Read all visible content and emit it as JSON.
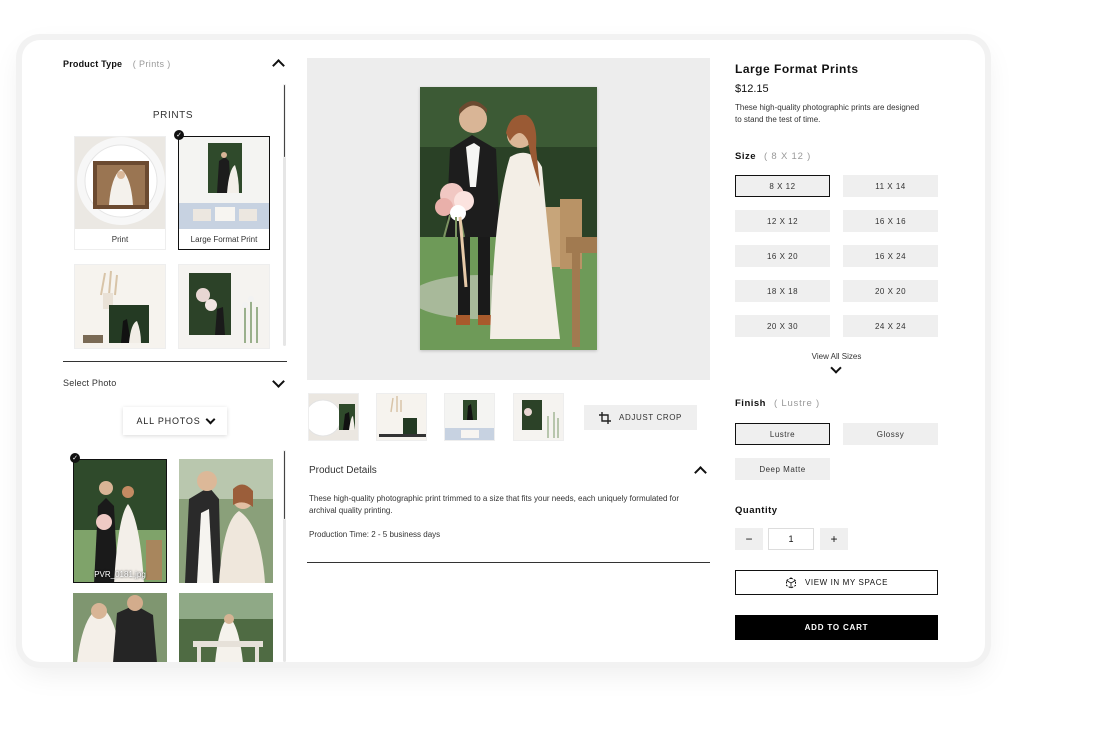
{
  "product_type": {
    "title": "Product Type",
    "selected": "( Prints )",
    "group_label": "PRINTS"
  },
  "product_tiles": [
    {
      "label": "Print"
    },
    {
      "label": "Large Format Print"
    },
    {
      "label": ""
    },
    {
      "label": ""
    }
  ],
  "select_photo": {
    "title": "Select Photo",
    "filter_label": "ALL PHOTOS"
  },
  "photos": [
    {
      "filename": "PVR_0181.jpg"
    }
  ],
  "actions": {
    "adjust_crop": "ADJUST CROP"
  },
  "product_details": {
    "title": "Product Details",
    "body": "These high-quality photographic print trimmed to a size that fits your needs, each uniquely formulated for archival quality printing.",
    "production_time": "Production Time: 2 - 5 business days"
  },
  "product": {
    "title": "Large Format Prints",
    "price": "$12.15",
    "description": "These high-quality photographic prints are designed to stand the test of time."
  },
  "size": {
    "label": "Size",
    "selected": "( 8 X 12 )",
    "options": [
      "8 X 12",
      "11 X 14",
      "12 X 12",
      "16 X 16",
      "16 X 20",
      "16 X 24",
      "18 X 18",
      "20 X 20",
      "20 X 30",
      "24 X 24"
    ],
    "view_all": "View All Sizes"
  },
  "finish": {
    "label": "Finish",
    "selected": "( Lustre )",
    "options": [
      "Lustre",
      "Glossy",
      "Deep Matte"
    ]
  },
  "quantity": {
    "label": "Quantity",
    "value": "1",
    "minus": "−",
    "plus": "+"
  },
  "buttons": {
    "view_in_space": "VIEW IN MY SPACE",
    "add_to_cart": "ADD TO CART"
  }
}
